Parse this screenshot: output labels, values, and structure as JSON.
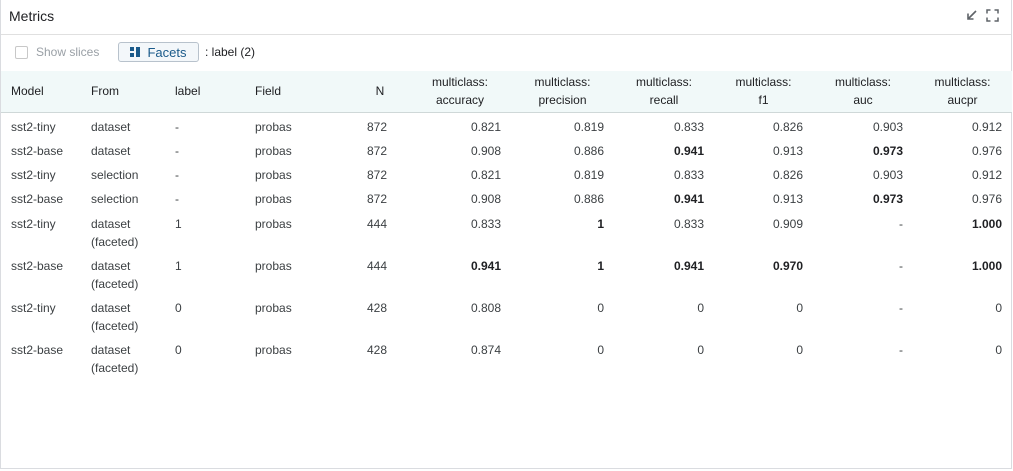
{
  "panel": {
    "title": "Metrics",
    "show_slices_label": "Show slices",
    "facets_label": "Facets",
    "facet_info": ": label (2)"
  },
  "table": {
    "headers": [
      {
        "l1": "Model",
        "l2": ""
      },
      {
        "l1": "From",
        "l2": ""
      },
      {
        "l1": "label",
        "l2": ""
      },
      {
        "l1": "Field",
        "l2": ""
      },
      {
        "l1": "N",
        "l2": ""
      },
      {
        "l1": "multiclass:",
        "l2": "accuracy"
      },
      {
        "l1": "multiclass:",
        "l2": "precision"
      },
      {
        "l1": "multiclass:",
        "l2": "recall"
      },
      {
        "l1": "multiclass:",
        "l2": "f1"
      },
      {
        "l1": "multiclass:",
        "l2": "auc"
      },
      {
        "l1": "multiclass:",
        "l2": "aucpr"
      }
    ],
    "rows": [
      {
        "model": "sst2-tiny",
        "from1": "dataset",
        "from2": "",
        "label": "-",
        "field": "probas",
        "n": "872",
        "accuracy": "0.821",
        "precision": "0.819",
        "recall": "0.833",
        "f1": "0.826",
        "auc": "0.903",
        "aucpr": "0.912",
        "bold": []
      },
      {
        "model": "sst2-base",
        "from1": "dataset",
        "from2": "",
        "label": "-",
        "field": "probas",
        "n": "872",
        "accuracy": "0.908",
        "precision": "0.886",
        "recall": "0.941",
        "f1": "0.913",
        "auc": "0.973",
        "aucpr": "0.976",
        "bold": [
          "recall",
          "auc"
        ]
      },
      {
        "model": "sst2-tiny",
        "from1": "selection",
        "from2": "",
        "label": "-",
        "field": "probas",
        "n": "872",
        "accuracy": "0.821",
        "precision": "0.819",
        "recall": "0.833",
        "f1": "0.826",
        "auc": "0.903",
        "aucpr": "0.912",
        "bold": []
      },
      {
        "model": "sst2-base",
        "from1": "selection",
        "from2": "",
        "label": "-",
        "field": "probas",
        "n": "872",
        "accuracy": "0.908",
        "precision": "0.886",
        "recall": "0.941",
        "f1": "0.913",
        "auc": "0.973",
        "aucpr": "0.976",
        "bold": [
          "recall",
          "auc"
        ]
      },
      {
        "model": "sst2-tiny",
        "from1": "dataset",
        "from2": "(faceted)",
        "label": "1",
        "field": "probas",
        "n": "444",
        "accuracy": "0.833",
        "precision": "1",
        "recall": "0.833",
        "f1": "0.909",
        "auc": "-",
        "aucpr": "1.000",
        "bold": [
          "precision",
          "aucpr"
        ]
      },
      {
        "model": "sst2-base",
        "from1": "dataset",
        "from2": "(faceted)",
        "label": "1",
        "field": "probas",
        "n": "444",
        "accuracy": "0.941",
        "precision": "1",
        "recall": "0.941",
        "f1": "0.970",
        "auc": "-",
        "aucpr": "1.000",
        "bold": [
          "accuracy",
          "precision",
          "recall",
          "f1",
          "aucpr"
        ]
      },
      {
        "model": "sst2-tiny",
        "from1": "dataset",
        "from2": "(faceted)",
        "label": "0",
        "field": "probas",
        "n": "428",
        "accuracy": "0.808",
        "precision": "0",
        "recall": "0",
        "f1": "0",
        "auc": "-",
        "aucpr": "0",
        "bold": []
      },
      {
        "model": "sst2-base",
        "from1": "dataset",
        "from2": "(faceted)",
        "label": "0",
        "field": "probas",
        "n": "428",
        "accuracy": "0.874",
        "precision": "0",
        "recall": "0",
        "f1": "0",
        "auc": "-",
        "aucpr": "0",
        "bold": []
      }
    ]
  },
  "colors": {
    "header_bg": "#f1f9f9",
    "facets_text": "#1a5a8a"
  }
}
